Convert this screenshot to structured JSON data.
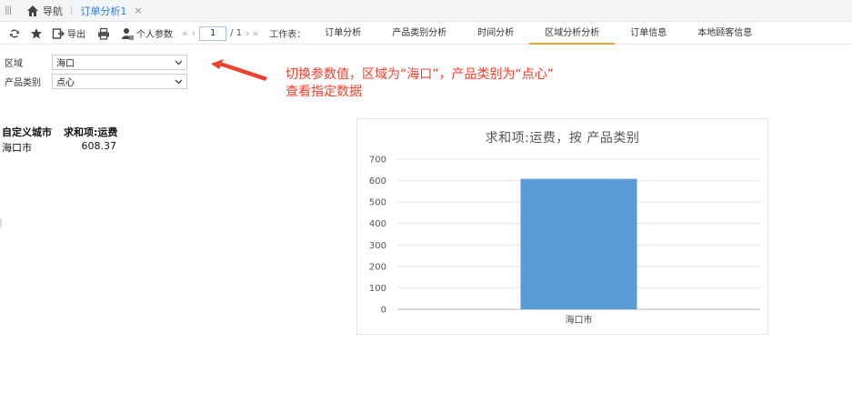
{
  "topbar": {
    "nav_label": "导航",
    "active_tab": "订单分析1",
    "close_glyph": "×"
  },
  "toolbar": {
    "export_label": "导出",
    "personal_params_label": "个人参数",
    "page_current": "1",
    "page_total": "/ 1",
    "worksheet_label": "工作表：",
    "sheets": [
      {
        "label": "订单分析",
        "active": false
      },
      {
        "label": "产品类别分析",
        "active": false
      },
      {
        "label": "时间分析",
        "active": false
      },
      {
        "label": "区域分析分析",
        "active": true
      },
      {
        "label": "订单信息",
        "active": false
      },
      {
        "label": "本地顾客信息",
        "active": false
      }
    ]
  },
  "params": {
    "region_label": "区域",
    "region_value": "海口",
    "category_label": "产品类别",
    "category_value": "点心"
  },
  "annotation": {
    "line1": "切换参数值，区域为“海口”，产品类别为“点心”",
    "line2": "查看指定数据"
  },
  "table": {
    "col1": "自定义城市",
    "col2": "求和项:运费",
    "rows": [
      {
        "city": "海口市",
        "value": "608.37"
      }
    ]
  },
  "chart_data": {
    "type": "bar",
    "title": "求和项:运费，按 产品类别",
    "categories": [
      "海口市"
    ],
    "values": [
      608.37
    ],
    "ylim": [
      0,
      700
    ],
    "yticks": [
      0,
      100,
      200,
      300,
      400,
      500,
      600,
      700
    ],
    "grid": true,
    "color": "#5b9bd5"
  },
  "colors": {
    "accent_blue": "#2f7fd8",
    "tab_underline": "#e8a33b",
    "annotation_red": "#f0412d"
  }
}
